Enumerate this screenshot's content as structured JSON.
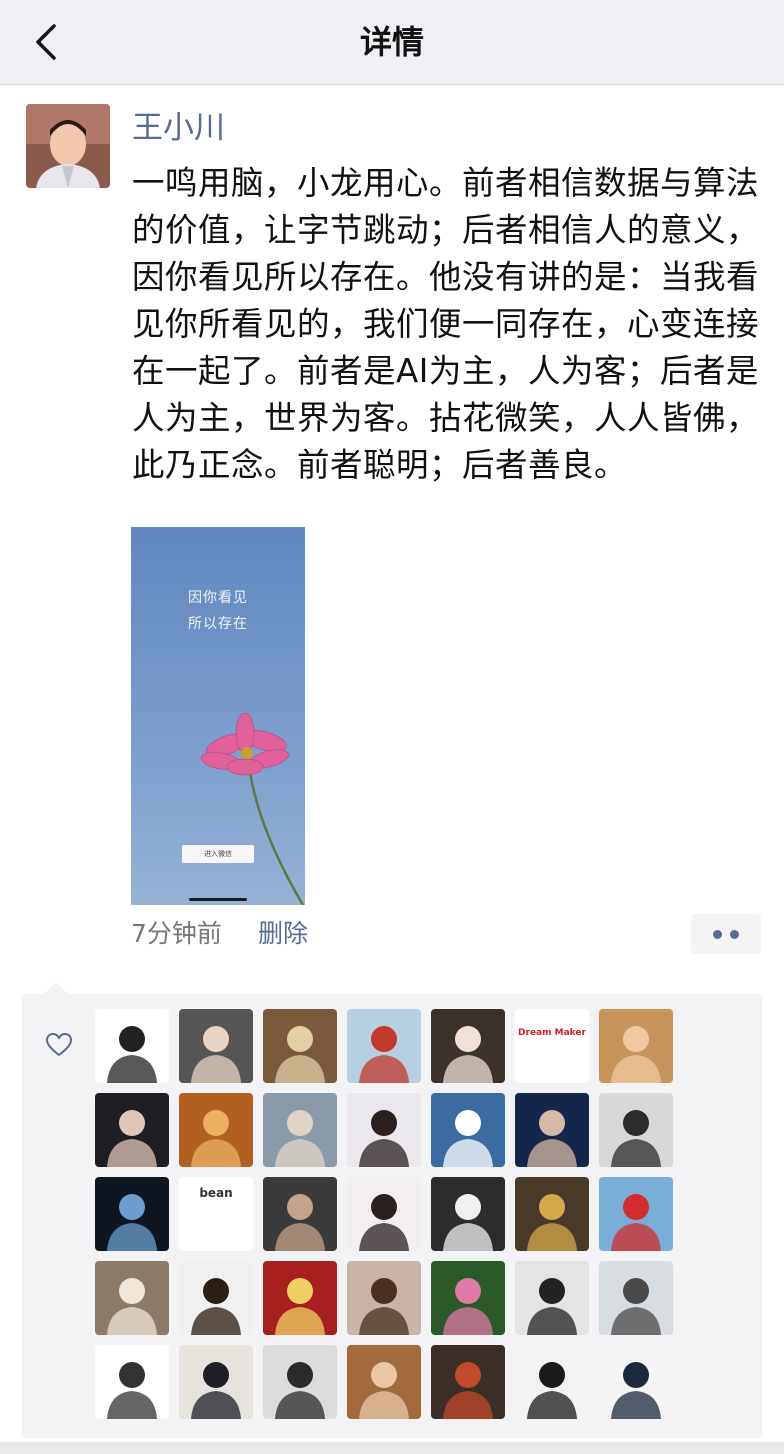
{
  "nav": {
    "title": "详情",
    "back_icon": "chevron-left-icon"
  },
  "post": {
    "author": "王小川",
    "text": "一鸣用脑，小龙用心。前者相信数据与算法的价值，让字节跳动；后者相信人的意义，因你看见所以存在。他没有讲的是：当我看见你所看见的，我们便一同存在，心变连接在一起了。前者是AI为主，人为客；后者是人为主，世界为客。拈花微笑，人人皆佛，此乃正念。前者聪明；后者善良。",
    "image": {
      "line1": "因你看见",
      "line2": "所以存在",
      "button": "进入微信",
      "sky_color": "#6a92c6",
      "flower_color": "#e0609a"
    },
    "time": "7分钟前",
    "delete_label": "删除",
    "more_icon": "more-dots-icon"
  },
  "likes": {
    "icon": "heart-icon",
    "avatars": [
      {
        "name": "cartoon-boy-avatar",
        "bg": "#ffffff",
        "fg": "#222222"
      },
      {
        "name": "man-in-vest-avatar",
        "bg": "#555555",
        "fg": "#e8d4c4"
      },
      {
        "name": "dog-avatar",
        "bg": "#7a5a3c",
        "fg": "#e2cfa6"
      },
      {
        "name": "torii-gate-avatar",
        "bg": "#b6cfe1",
        "fg": "#c0392b"
      },
      {
        "name": "woman-in-white-avatar",
        "bg": "#3c322c",
        "fg": "#f0e0d6"
      },
      {
        "name": "dream-maker-logo-avatar",
        "bg": "#ffffff",
        "fg": "#d21f24",
        "label": "Dream Maker"
      },
      {
        "name": "cartoon-face-avatar",
        "bg": "#c7955c",
        "fg": "#f0c9a0"
      },
      {
        "name": "woman-portrait-avatar",
        "bg": "#1e1e24",
        "fg": "#e0c6b8"
      },
      {
        "name": "autumn-leaves-avatar",
        "bg": "#b25f22",
        "fg": "#ecb062"
      },
      {
        "name": "group-photo-avatar",
        "bg": "#8b9aa9",
        "fg": "#e0d4c8"
      },
      {
        "name": "woman-in-hat-avatar",
        "bg": "#eae8ec",
        "fg": "#2a2020"
      },
      {
        "name": "cloudy-sky-avatar",
        "bg": "#3a6ca2",
        "fg": "#ffffff"
      },
      {
        "name": "woman-in-blue-avatar",
        "bg": "#14264a",
        "fg": "#d6b8a6"
      },
      {
        "name": "woman-with-glasses-avatar",
        "bg": "#d6d8da",
        "fg": "#2c2c2c"
      },
      {
        "name": "dark-car-avatar",
        "bg": "#10161f",
        "fg": "#6c9fd0"
      },
      {
        "name": "bean-sketch-avatar",
        "bg": "#ffffff",
        "fg": "#333333",
        "label": "bean"
      },
      {
        "name": "boxer-avatar",
        "bg": "#3b3b3b",
        "fg": "#c4a48a"
      },
      {
        "name": "smiling-woman-avatar",
        "bg": "#f3eff0",
        "fg": "#2a2020"
      },
      {
        "name": "stormtrooper-avatar",
        "bg": "#2c2c2c",
        "fg": "#f0f0f0"
      },
      {
        "name": "man-with-guitar-avatar",
        "bg": "#4a3a2a",
        "fg": "#d6a84a"
      },
      {
        "name": "couple-by-sea-avatar",
        "bg": "#79aed8",
        "fg": "#d22c2c"
      },
      {
        "name": "grumpy-cat-avatar",
        "bg": "#8a7a68",
        "fg": "#f0e6d8"
      },
      {
        "name": "man-in-suit-avatar",
        "bg": "#f0f0f0",
        "fg": "#2b1e12"
      },
      {
        "name": "event-banner-avatar",
        "bg": "#a82020",
        "fg": "#f0d060"
      },
      {
        "name": "girl-portrait-avatar",
        "bg": "#c8b4a8",
        "fg": "#4a3020"
      },
      {
        "name": "lotus-avatar",
        "bg": "#2a5a2a",
        "fg": "#e07aa6"
      },
      {
        "name": "woman-profile-avatar",
        "bg": "#e4e4e4",
        "fg": "#222222"
      },
      {
        "name": "mountain-hiker-avatar",
        "bg": "#d8dde2",
        "fg": "#4a4a4a"
      },
      {
        "name": "line-art-face-avatar",
        "bg": "#ffffff",
        "fg": "#333333"
      },
      {
        "name": "woman-in-blazer-avatar",
        "bg": "#e6e2dc",
        "fg": "#1e1e28"
      },
      {
        "name": "man-with-glasses-avatar",
        "bg": "#dcdcdc",
        "fg": "#2a2a2a"
      },
      {
        "name": "blurry-portrait-avatar",
        "bg": "#a36a3c",
        "fg": "#e8c8a8"
      },
      {
        "name": "tea-cups-avatar",
        "bg": "#3a2e26",
        "fg": "#c24a2a"
      },
      {
        "name": "woman-black-hair-avatar",
        "bg": "#f2f2f2",
        "fg": "#1a1a1a"
      },
      {
        "name": "man-in-tie-avatar",
        "bg": "#f4f4f4",
        "fg": "#1c2a3c"
      }
    ]
  }
}
